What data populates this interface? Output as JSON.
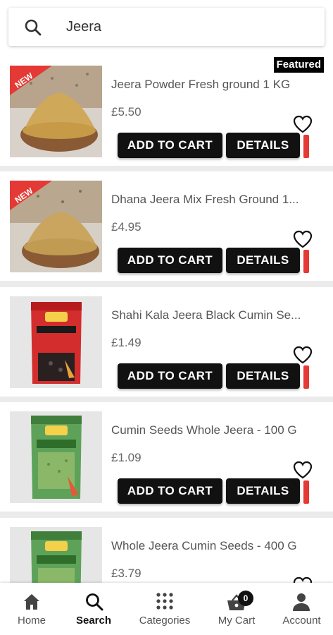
{
  "search": {
    "value": "Jeera",
    "placeholder": ""
  },
  "colors": {
    "button_bg": "#111111",
    "accent_red": "#e53935",
    "new_badge": "#e53935"
  },
  "products": [
    {
      "name": "Jeera Powder Fresh ground 1 KG",
      "price": "£5.50",
      "badge": "NEW",
      "featured": "Featured",
      "image": "jeera-powder-bowl"
    },
    {
      "name": "Dhana Jeera Mix Fresh Ground 1...",
      "price": "£4.95",
      "badge": "NEW",
      "image": "dhana-jeera-bowl"
    },
    {
      "name": "Shahi Kala Jeera Black Cumin Se...",
      "price": "£1.49",
      "image": "trs-red-packet"
    },
    {
      "name": "Cumin Seeds Whole Jeera - 100 G",
      "price": "£1.09",
      "image": "trs-green-packet"
    },
    {
      "name": "Whole Jeera Cumin Seeds - 400 G",
      "price": "£3.79",
      "image": "trs-green-packet"
    }
  ],
  "actions": {
    "add_to_cart": "ADD TO CART",
    "details": "DETAILS"
  },
  "nav": {
    "items": [
      {
        "label": "Home",
        "icon": "home-icon"
      },
      {
        "label": "Search",
        "icon": "search-icon",
        "active": true
      },
      {
        "label": "Categories",
        "icon": "grid-icon"
      },
      {
        "label": "My Cart",
        "icon": "cart-icon",
        "count": "0"
      },
      {
        "label": "Account",
        "icon": "person-icon"
      }
    ]
  }
}
